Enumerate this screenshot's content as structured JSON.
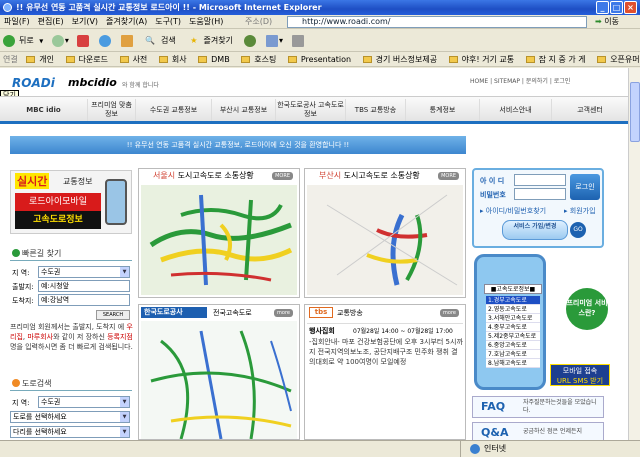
{
  "window": {
    "title": "!! 유무선 연동 고품격 실시간 교통정보 로드아이 !! - Microsoft Internet Explorer"
  },
  "menu": [
    "파일(F)",
    "편집(E)",
    "보기(V)",
    "즐겨찾기(A)",
    "도구(T)",
    "도움말(H)"
  ],
  "address": {
    "label": "주소(D)",
    "url": "http://www.roadi.com/",
    "go": "이동"
  },
  "toolbar": {
    "back": "뒤로",
    "search": "검색",
    "favorites": "즐겨찾기"
  },
  "links": {
    "label": "연결",
    "items": [
      "개인",
      "다운로드",
      "사전",
      "회사",
      "DMB",
      "호스팅",
      "Presentation",
      "경기 버스정보제공",
      "야후! 거기 교통",
      "잡 지 중 가 게",
      "오픈유머"
    ]
  },
  "page": {
    "brand_main": "ROADi",
    "brand_sub": "mbcidio",
    "greeting": "와 함께 합니다",
    "close_tip": "닫기",
    "topnav": [
      "HOME",
      "SITEMAP",
      "문의하기",
      "로그인"
    ],
    "nav": [
      {
        "label": "MBC idio"
      },
      {
        "label": "프리미엄 맞춤정보"
      },
      {
        "label": "수도권 교통정보"
      },
      {
        "label": "부산시 교통정보"
      },
      {
        "label": "한국도로공사 고속도로정보"
      },
      {
        "label": "TBS 교통방송"
      },
      {
        "label": "통계정보"
      },
      {
        "label": "서비스안내"
      },
      {
        "label": "고객센터"
      }
    ],
    "welcome": "!! 유무선 연동 고품격 실시간 교통정보, 로드아이에 오신 것을 환영합니다 !!",
    "promo": {
      "tag": "실시간",
      "tag2": "교통정보",
      "line1": "로드아이모바일",
      "line2": "고속도로정보"
    },
    "quick": {
      "title": "빠른길 찾기",
      "region_label": "지  역:",
      "region_value": "수도권",
      "from_label": "출발지:",
      "from_value": "예:시청앞",
      "to_label": "도착지:",
      "to_value": "예:강남역",
      "search": "SEARCH",
      "desc1": "프리미엄 회원께서는 출발지, 도착지",
      "desc2": "에 ",
      "hl1": "우리집",
      "desc3": ", ",
      "hl2": "마루회사",
      "desc4": "와 같이 저",
      "desc5": "장하신 ",
      "hl3": "등록지점",
      "desc6": "명을 입력하시면",
      "desc7": "좀 더 빠르게 검색됩니다."
    },
    "road": {
      "title": "도로검색",
      "region_label": "지  역:",
      "region_value": "수도권",
      "road_select": "도로를 선택하세요",
      "bridge_select": "다리를 선택하세요"
    },
    "seoul": {
      "title": "서울시",
      "subtitle": "도시고속도로 소통상황",
      "more": "MORE"
    },
    "busan": {
      "title": "부산시",
      "subtitle": "도시고속도로 소통상황",
      "more": "MORE"
    },
    "expressway": {
      "logo": "한국도로공사",
      "title": "전국고속도로",
      "more": "more"
    },
    "tbs": {
      "logo": "tbs",
      "title": "교통방송",
      "more": "more",
      "event_tag": "행사집회",
      "event_time": "07월28일 14:00 ~ 07월28일 17:00",
      "event_text": "-집회안내- 마포 건강보험공단에 오후 3시부터 5시까지 전국지역의보노조, 공단지배구조 민주화 쟁취 결의대회로 약 100여명이 모일예정"
    },
    "login": {
      "id_label": "아 이 디",
      "pw_label": "비밀번호",
      "login_btn": "로그인",
      "find": "아이디/비밀번호찾기",
      "join": "회원가입"
    },
    "service": {
      "btn": "서비스 가입/변경",
      "go": "GO"
    },
    "phone": {
      "header": "■고속도로정보■",
      "items": [
        "1.경부고속도로",
        "2.영동고속도로",
        "3.서해안고속도로",
        "4.중부고속도로",
        "5.제2중부고속도로",
        "6.중앙고속도로",
        "7.호남고속도로",
        "8.남해고속도로"
      ],
      "bubble": "프리미엄 서비스란?",
      "sms1": "모바일 접속",
      "sms2": "URL SMS 받기"
    },
    "faq": {
      "title": "FAQ",
      "text": "자주질문하는것들을 모았습니다."
    },
    "qna": {
      "title": "Q&A",
      "text": "궁금하신 점은 언제든지"
    }
  },
  "status": {
    "zone": "인터넷"
  },
  "colors": {
    "nav_blue": "#1d6fc0",
    "welcome": "#4a90d9",
    "orange": "#f08a24",
    "phone": "#8ec8f0"
  }
}
